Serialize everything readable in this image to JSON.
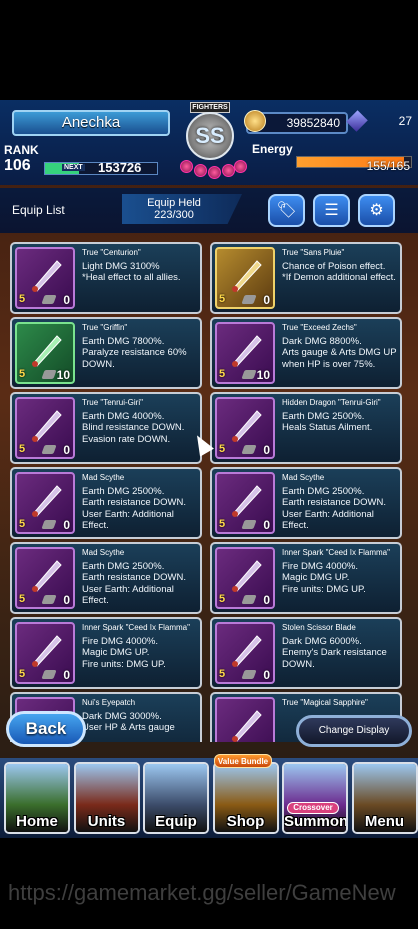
{
  "header": {
    "player_name": "Anechka",
    "rank_label": "RANK",
    "rank_value": "106",
    "next_label": "NEXT",
    "next_exp": "153726",
    "exp_fraction": 0.3,
    "emblem_banner": "FIGHTERS",
    "emblem_text": "SS",
    "gil": "39852840",
    "gems": "27",
    "energy_label": "Energy",
    "energy_value": "155/165",
    "energy_fraction": 0.94
  },
  "listbar": {
    "title": "Equip List",
    "held_label": "Equip Held",
    "held_value": "223/300",
    "icons": [
      "tag-icon",
      "filter-icon",
      "gear-icon"
    ]
  },
  "cards": [
    {
      "title": "True \"Centurion\"",
      "desc": "Light DMG 3100%\n*Heal effect to all allies.",
      "stars": "5",
      "num": "0",
      "theme": "purple"
    },
    {
      "title": "True \"Sans Pluie\"",
      "desc": "Chance of Poison effect.\n*If Demon additional effect.",
      "stars": "5",
      "num": "0",
      "theme": "gold"
    },
    {
      "title": "True \"Griffin\"",
      "desc": "Earth DMG 7800%.\nParalyze resistance 60% DOWN.",
      "stars": "5",
      "num": "10",
      "theme": "green"
    },
    {
      "title": "True \"Exceed Zechs\"",
      "desc": "Dark DMG 8800%.\nArts gauge & Arts DMG UP when HP is over 75%.",
      "stars": "5",
      "num": "10",
      "theme": "purple"
    },
    {
      "title": "True \"Tenrui-Giri\"",
      "desc": "Earth DMG 4000%.\nBlind resistance DOWN.\nEvasion rate DOWN.",
      "stars": "5",
      "num": "0",
      "theme": "purple"
    },
    {
      "title": "Hidden Dragon \"Tenrui-Giri\"",
      "desc": "Earth DMG 2500%.\nHeals Status Ailment.",
      "stars": "5",
      "num": "0",
      "theme": "purple"
    },
    {
      "title": "Mad Scythe",
      "desc": "Earth DMG 2500%.\nEarth resistance DOWN. User Earth: Additional Effect.",
      "stars": "5",
      "num": "0",
      "theme": "purple"
    },
    {
      "title": "Mad Scythe",
      "desc": "Earth DMG 2500%.\nEarth resistance DOWN. User Earth: Additional Effect.",
      "stars": "5",
      "num": "0",
      "theme": "purple"
    },
    {
      "title": "Mad Scythe",
      "desc": "Earth DMG 2500%.\nEarth resistance DOWN. User Earth: Additional Effect.",
      "stars": "5",
      "num": "0",
      "theme": "purple"
    },
    {
      "title": "Inner Spark \"Ceed Ix Flamma\"",
      "desc": "Fire DMG 4000%.\nMagic DMG UP.\nFire units: DMG UP.",
      "stars": "5",
      "num": "0",
      "theme": "purple"
    },
    {
      "title": "Inner Spark \"Ceed Ix Flamma\"",
      "desc": "Fire DMG 4000%.\nMagic DMG UP.\nFire units: DMG UP.",
      "stars": "5",
      "num": "0",
      "theme": "purple"
    },
    {
      "title": "Stolen Scissor Blade",
      "desc": "Dark DMG 6000%.\nEnemy's Dark resistance DOWN.",
      "stars": "5",
      "num": "0",
      "theme": "purple"
    },
    {
      "title": "Nui's Eyepatch",
      "desc": "Dark DMG 3000%.\nUser HP & Arts gauge",
      "stars": "5",
      "num": "0",
      "theme": "purple"
    },
    {
      "title": "True \"Magical Sapphire\"",
      "desc": "",
      "stars": "5",
      "num": "0",
      "theme": "purple"
    }
  ],
  "buttons": {
    "back": "Back",
    "change_display": "Change Display"
  },
  "nav": [
    {
      "label": "Home",
      "icon": "house-icon"
    },
    {
      "label": "Units",
      "icon": "hero-icon"
    },
    {
      "label": "Equip",
      "icon": "sword-icon"
    },
    {
      "label": "Shop",
      "icon": "treasure-chest-icon"
    },
    {
      "label": "Summon",
      "icon": "moogle-icon"
    },
    {
      "label": "Menu",
      "icon": "book-icon"
    }
  ],
  "value_bundle_tag": "Value Bundle",
  "crossover_tag": "Crossover",
  "watermark": "https://gamemarket.gg/seller/GameNew"
}
